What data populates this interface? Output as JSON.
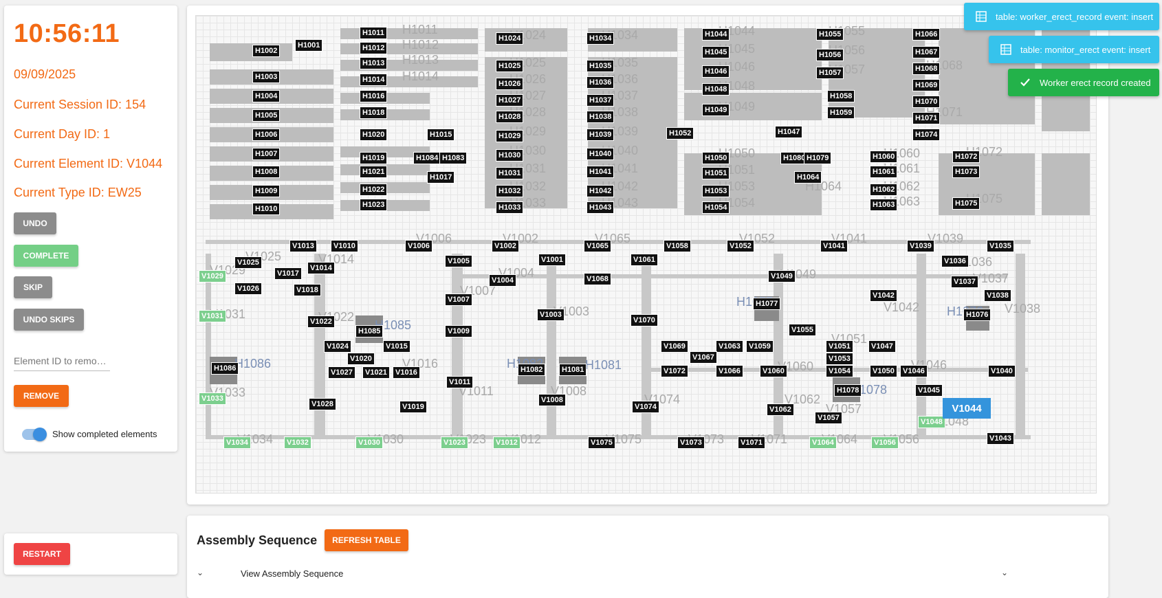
{
  "status": {
    "time": "10:56:11",
    "date": "09/09/2025",
    "session": "Current Session ID: 154",
    "day": "Current Day ID: 1",
    "element": "Current Element ID: V1044",
    "type": "Current Type ID: EW25"
  },
  "buttons": {
    "undo": "UNDO",
    "complete": "COMPLETE",
    "skip": "SKIP",
    "undo_skips": "UNDO SKIPS",
    "remove": "REMOVE",
    "restart": "RESTART",
    "refresh_table": "REFRESH TABLE"
  },
  "remove_input": {
    "placeholder": "Element ID to remo…",
    "value": ""
  },
  "toggle": {
    "label": "Show completed elements",
    "on": true
  },
  "colors": {
    "accent": "#f26a15",
    "complete": "#74cf86",
    "current": "#3494dc",
    "toast_info": "#36c3ec",
    "toast_ok": "#23b24a"
  },
  "toasts": [
    {
      "icon": "table-icon",
      "text": "table: worker_erect_record event: insert"
    },
    {
      "icon": "table-icon",
      "text": "table: monitor_erect event: insert"
    },
    {
      "icon": "check-icon",
      "text": "Worker erect record created"
    }
  ],
  "map": {
    "current_element": "V1044",
    "tags": [
      "H1002",
      "H1001",
      "H1011",
      "H1012",
      "H1013",
      "H1014",
      "H1016",
      "H1018",
      "H1003",
      "H1004",
      "H1005",
      "H1006",
      "H1007",
      "H1008",
      "H1009",
      "H1010",
      "H1020",
      "H1019",
      "H1021",
      "H1022",
      "H1023",
      "H1015",
      "H1084",
      "H1083",
      "H1017",
      "H1024",
      "H1025",
      "H1026",
      "H1027",
      "H1028",
      "H1029",
      "H1030",
      "H1031",
      "H1032",
      "H1033",
      "H1034",
      "H1035",
      "H1036",
      "H1037",
      "H1038",
      "H1039",
      "H1040",
      "H1041",
      "H1042",
      "H1043",
      "H1044",
      "H1045",
      "H1046",
      "H1048",
      "H1049",
      "H1052",
      "H1050",
      "H1051",
      "H1053",
      "H1054",
      "H1055",
      "H1056",
      "H1057",
      "H1058",
      "H1059",
      "H1047",
      "H1080",
      "H1079",
      "H1064",
      "H1066",
      "H1067",
      "H1068",
      "H1069",
      "H1070",
      "H1071",
      "H1074",
      "H1060",
      "H1061",
      "H1062",
      "H1063",
      "H1072",
      "H1073",
      "H1075",
      "V1013",
      "V1010",
      "V1025",
      "V1017",
      "V1014",
      "V1026",
      "V1018",
      "V1006",
      "V1002",
      "V1065",
      "V1058",
      "V1052",
      "V1041",
      "V1039",
      "V1035",
      "V1005",
      "V1001",
      "V1061",
      "V1036",
      "V1004",
      "V1068",
      "V1049",
      "V1037",
      "V1007",
      "V1042",
      "V1038",
      "H1077",
      "V1022",
      "V1003",
      "V1070",
      "H1076",
      "H1085",
      "V1009",
      "V1055",
      "V1024",
      "V1015",
      "V1069",
      "V1063",
      "V1059",
      "V1051",
      "V1047",
      "V1020",
      "V1067",
      "V1053",
      "H1086",
      "V1027",
      "V1021",
      "V1016",
      "H1082",
      "H1081",
      "V1072",
      "V1066",
      "V1060",
      "V1054",
      "V1050",
      "V1046",
      "V1040",
      "V1011",
      "H1078",
      "V1045",
      "V1028",
      "V1008",
      "V1019",
      "V1074",
      "V1062",
      "V1057",
      "V1043",
      "V1075",
      "V1073",
      "V1071"
    ],
    "completed_tags": [
      "V1029",
      "V1031",
      "V1033",
      "V1034",
      "V1032",
      "V1030",
      "V1023",
      "V1012",
      "V1064",
      "V1056",
      "V1048"
    ],
    "ghost_labels": [
      "H1011",
      "H1012",
      "H1013",
      "H1014",
      "H1024",
      "H1025",
      "H1026",
      "H1027",
      "H1028",
      "H1029",
      "H1030",
      "H1031",
      "H1032",
      "H1033",
      "H1034",
      "H1035",
      "H1036",
      "H1037",
      "H1038",
      "H1039",
      "H1040",
      "H1041",
      "H1042",
      "H1043",
      "H1044",
      "H1045",
      "H1046",
      "H1048",
      "H1049",
      "H1050",
      "H1051",
      "H1053",
      "H1054",
      "H1055",
      "H1056",
      "H1057",
      "H1060",
      "H1061",
      "H1062",
      "H1063",
      "H1064",
      "H1068",
      "H1071",
      "H1072",
      "H1075",
      "V1006",
      "V1002",
      "V1065",
      "V1052",
      "V1041",
      "V1039",
      "V1036",
      "V1037",
      "V1038",
      "V1042",
      "V1049",
      "V1003",
      "V1008",
      "V1011",
      "V1016",
      "V1057",
      "V1062",
      "V1074",
      "V1075",
      "V1073",
      "V1071",
      "V1034",
      "V1030",
      "V1012",
      "V1023",
      "V1064",
      "V1056",
      "V1048",
      "V1031",
      "V1033",
      "V1029",
      "V1025",
      "V1014",
      "V1022",
      "V1004",
      "V1007",
      "V1060",
      "V1051",
      "V1046"
    ],
    "blue_labels": [
      "H1085",
      "H1086",
      "H1082",
      "H1081",
      "H1077",
      "H1078",
      "H1076"
    ]
  },
  "sequence": {
    "title": "Assembly Sequence",
    "view_label": "View Assembly Sequence"
  }
}
